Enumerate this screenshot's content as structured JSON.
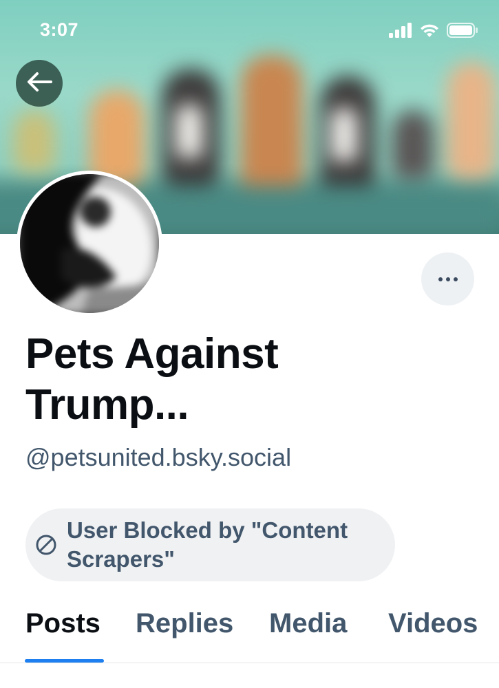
{
  "status_bar": {
    "time": "3:07",
    "icons": [
      "signal-icon",
      "wifi-icon",
      "battery-icon"
    ]
  },
  "header": {
    "back_icon": "arrow-left-icon",
    "more_icon": "ellipsis-icon"
  },
  "profile": {
    "display_name": "Pets Against Trump...",
    "handle": "@petsunited.bsky.social",
    "blocked_label": "User Blocked by \"Content Scrapers\"",
    "blocked_icon": "blocked-circle-icon"
  },
  "tabs": [
    {
      "label": "Posts",
      "active": true
    },
    {
      "label": "Replies",
      "active": false
    },
    {
      "label": "Media",
      "active": false
    },
    {
      "label": "Videos",
      "active": false
    }
  ],
  "colors": {
    "accent": "#1d7ff0",
    "muted_text": "#42576c",
    "primary_text": "#0b0f14",
    "pill_bg": "#f0f1f3"
  }
}
